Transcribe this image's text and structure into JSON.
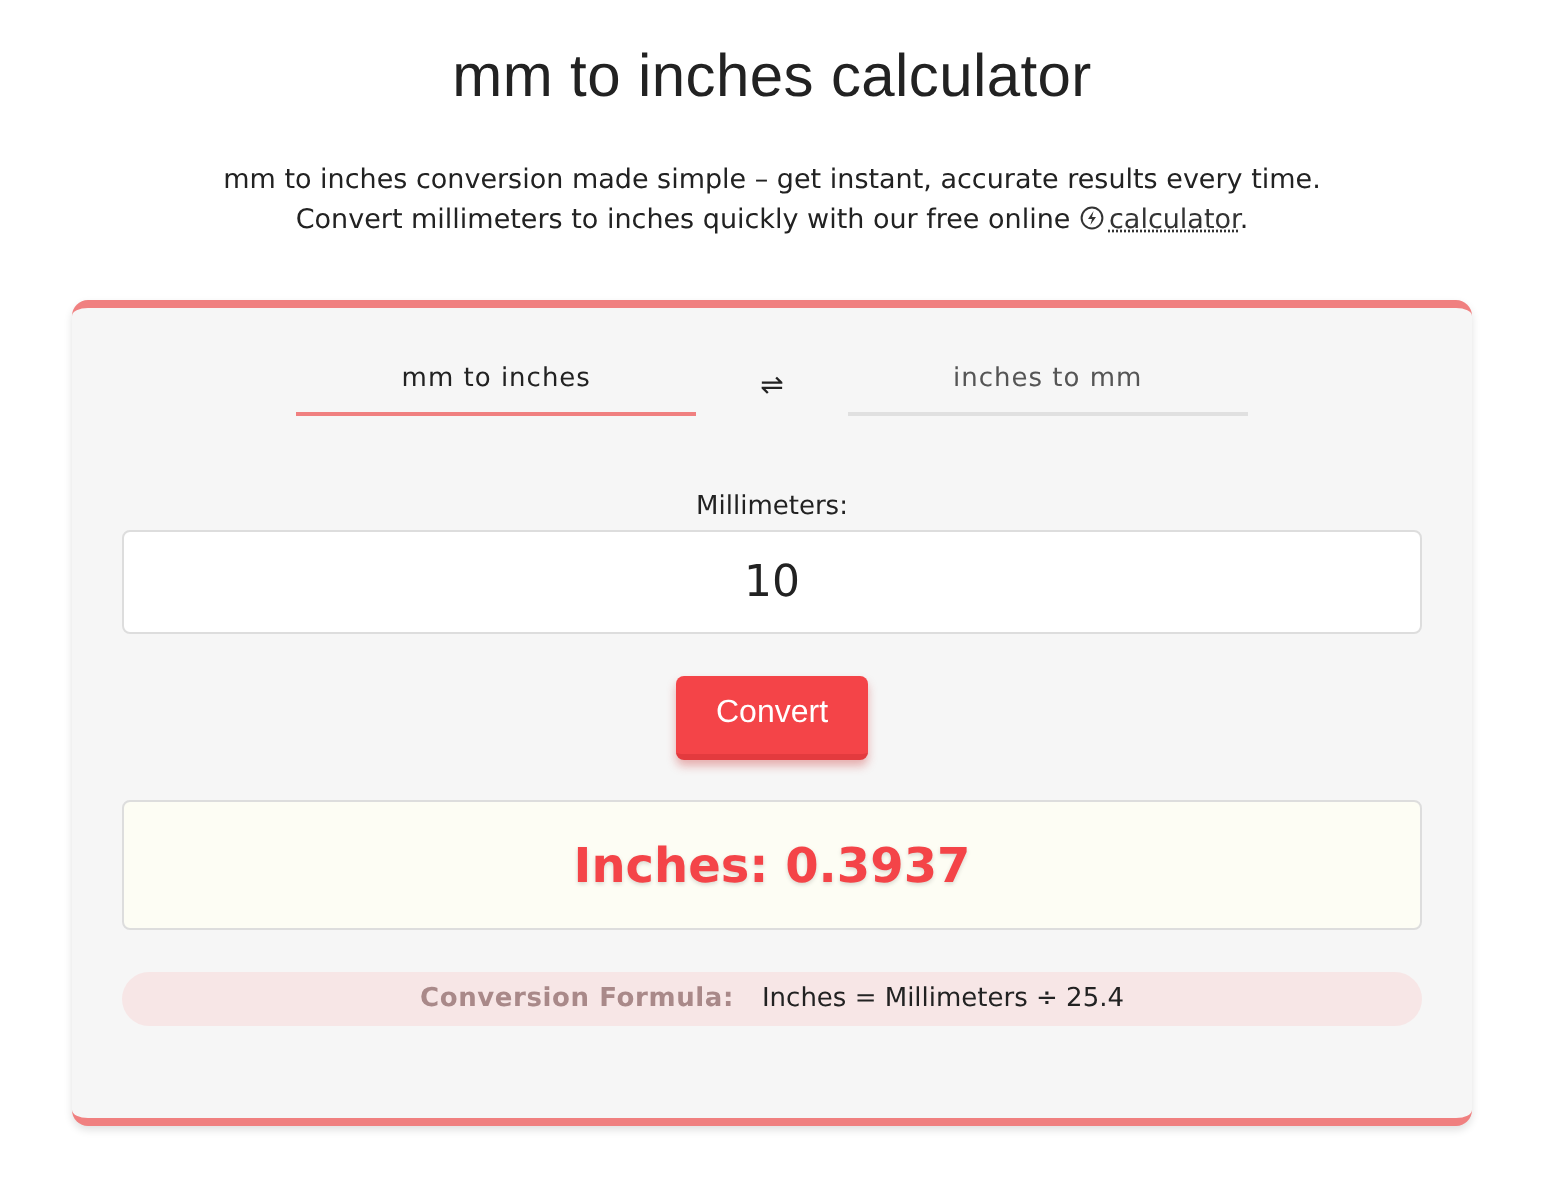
{
  "title": "mm to inches calculator",
  "intro": {
    "line_1": "mm to inches conversion made simple – get instant, accurate results every time.",
    "line_2": "Convert millimeters to inches quickly with our free online",
    "link": "calculator",
    "after_link": "."
  },
  "tabs": [
    {
      "label": "mm to inches",
      "selected": true
    },
    {
      "label": "inches to mm",
      "selected": false
    }
  ],
  "swap_symbol": "⇌",
  "field": {
    "label": "Millimeters:",
    "value": "10"
  },
  "button": "Convert",
  "result": "Inches: 0.3937",
  "formula": {
    "label": "Conversion Formula:",
    "text": "Inches = Millimeters ÷ 25.4"
  }
}
